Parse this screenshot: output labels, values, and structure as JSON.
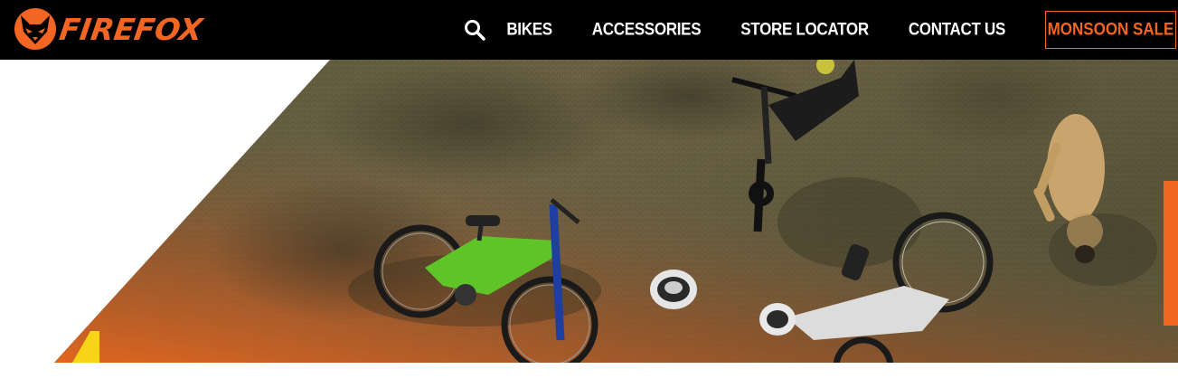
{
  "brand": {
    "name": "FIREFOX",
    "logo_icon": "fox-head-icon",
    "accent_color": "#f26522"
  },
  "nav": {
    "search_icon": "search-icon",
    "items": [
      {
        "label": "BIKES"
      },
      {
        "label": "ACCESSORIES"
      },
      {
        "label": "STORE LOCATOR"
      },
      {
        "label": "CONTACT US"
      }
    ],
    "sale_label": "MONSOON SALE"
  },
  "hero": {
    "image_subject": "kids bicycles lying on grass with helmets and a dog",
    "side_tab_color": "#f26522"
  }
}
